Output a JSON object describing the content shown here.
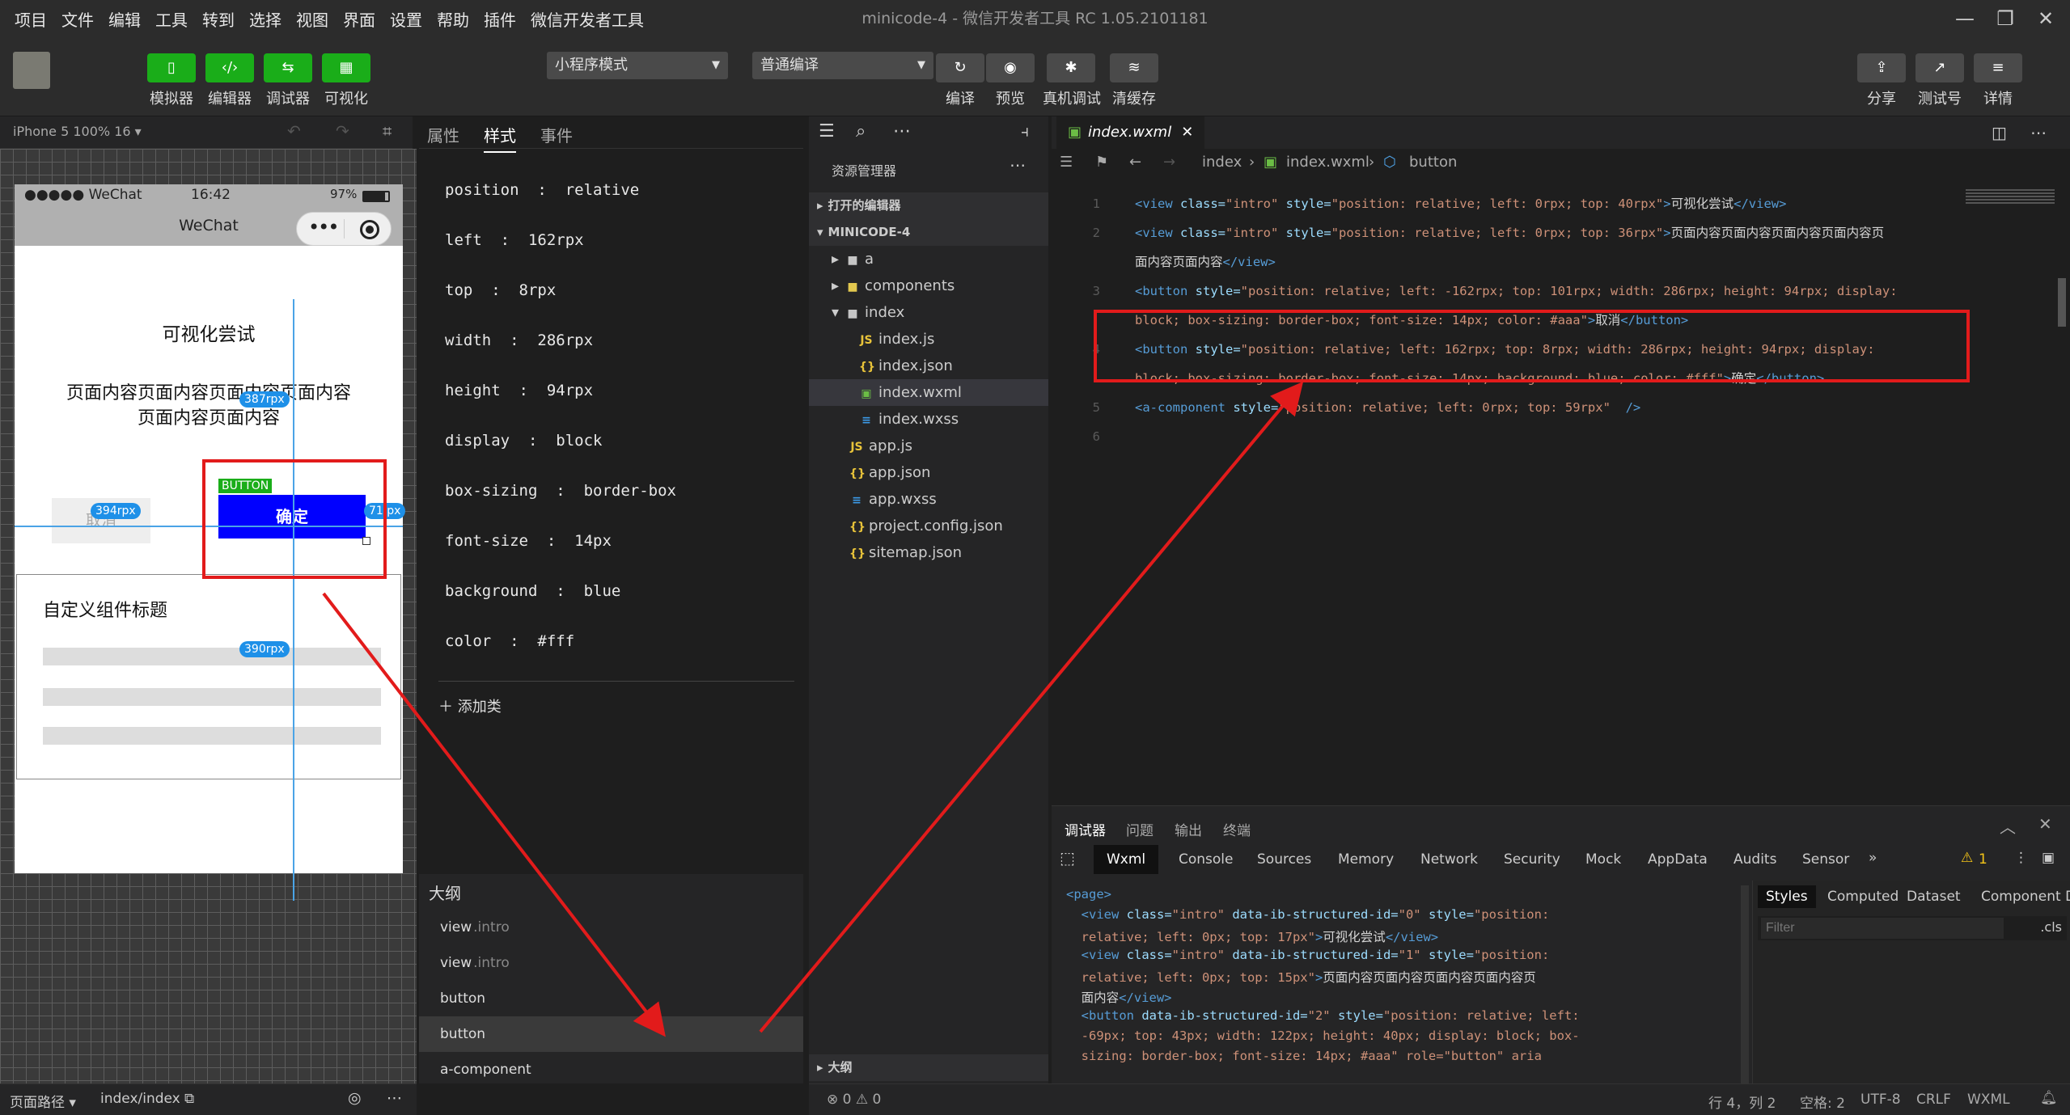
{
  "menubar": {
    "items": [
      "项目",
      "文件",
      "编辑",
      "工具",
      "转到",
      "选择",
      "视图",
      "界面",
      "设置",
      "帮助",
      "插件",
      "微信开发者工具"
    ],
    "title": "minicode-4 - 微信开发者工具 RC 1.05.2101181"
  },
  "toolbar": {
    "simulator": "模拟器",
    "editor": "编辑器",
    "debugger": "调试器",
    "visual": "可视化",
    "mode_select": "小程序模式",
    "compile_select": "普通编译",
    "compile": "编译",
    "preview": "预览",
    "real_debug": "真机调试",
    "clear_cache": "清缓存",
    "share": "分享",
    "test_account": "测试号",
    "details": "详情"
  },
  "simulator": {
    "device": "iPhone 5 100% 16 ▾",
    "status_carrier": "●●●●● WeChat",
    "status_time": "16:42",
    "status_battery": "97%",
    "nav_title": "WeChat",
    "text1": "可视化尝试",
    "text2_line1": "页面内容页面内容页面内容页面内容",
    "text2_line2": "页面内容页面内容",
    "cancel_btn": "取消",
    "confirm_btn": "确定",
    "button_tag": "BUTTON",
    "component_title": "自定义组件标题",
    "tag_394": "394rpx",
    "tag_387": "387rpx",
    "tag_71": "71 px",
    "tag_390": "390rpx"
  },
  "inspector": {
    "tab_attrs": "属性",
    "tab_style": "样式",
    "tab_events": "事件",
    "props": [
      {
        "k": "position",
        "v": "relative"
      },
      {
        "k": "left",
        "v": "162rpx"
      },
      {
        "k": "top",
        "v": "8rpx"
      },
      {
        "k": "width",
        "v": "286rpx"
      },
      {
        "k": "height",
        "v": "94rpx"
      },
      {
        "k": "display",
        "v": "block"
      },
      {
        "k": "box-sizing",
        "v": "border-box"
      },
      {
        "k": "font-size",
        "v": "14px"
      },
      {
        "k": "background",
        "v": "blue"
      },
      {
        "k": "color",
        "v": "#fff"
      }
    ],
    "add_class": "添加类"
  },
  "outline": {
    "title": "大纲",
    "items": [
      {
        "name": "view",
        "cls": ".intro"
      },
      {
        "name": "view",
        "cls": ".intro"
      },
      {
        "name": "button",
        "cls": ""
      },
      {
        "name": "button",
        "cls": ""
      },
      {
        "name": "a-component",
        "cls": ""
      }
    ]
  },
  "left_status": {
    "page_path_label": "页面路径 ▾",
    "page_path": "index/index"
  },
  "explorer": {
    "title": "资源管理器",
    "open_editors": "打开的编辑器",
    "project": "MINICODE-4",
    "outline": "大纲",
    "items": [
      {
        "name": "a",
        "kind": "folder"
      },
      {
        "name": "components",
        "kind": "folder"
      },
      {
        "name": "index",
        "kind": "folder-open"
      },
      {
        "name": "index.js",
        "kind": "js"
      },
      {
        "name": "index.json",
        "kind": "json"
      },
      {
        "name": "index.wxml",
        "kind": "wxml"
      },
      {
        "name": "index.wxss",
        "kind": "wxss"
      },
      {
        "name": "app.js",
        "kind": "js"
      },
      {
        "name": "app.json",
        "kind": "json"
      },
      {
        "name": "app.wxss",
        "kind": "wxss"
      },
      {
        "name": "project.config.json",
        "kind": "json"
      },
      {
        "name": "sitemap.json",
        "kind": "json"
      }
    ]
  },
  "editor": {
    "tab": "index.wxml",
    "crumb1": "index",
    "crumb2": "index.wxml",
    "crumb3": "button",
    "lines": [
      {
        "n": "1",
        "parts": [
          [
            "tg",
            "<view "
          ],
          [
            "at",
            "class="
          ],
          [
            "st",
            "\"intro\""
          ],
          [
            "at",
            " style="
          ],
          [
            "st",
            "\"position: relative; left: 0rpx; top: 40rpx\""
          ],
          [
            "tg",
            ">"
          ],
          [
            "tx",
            "可视化尝试"
          ],
          [
            "tg",
            "</view>"
          ]
        ]
      },
      {
        "n": "2",
        "parts": [
          [
            "tg",
            "<view "
          ],
          [
            "at",
            "class="
          ],
          [
            "st",
            "\"intro\""
          ],
          [
            "at",
            " style="
          ],
          [
            "st",
            "\"position: relative; left: 0rpx; top: 36rpx\""
          ],
          [
            "tg",
            ">"
          ],
          [
            "tx",
            "页面内容页面内容页面内容页面内容页"
          ]
        ]
      },
      {
        "n": "",
        "parts": [
          [
            "tx",
            "面内容页面内容"
          ],
          [
            "tg",
            "</view>"
          ]
        ]
      },
      {
        "n": "3",
        "parts": [
          [
            "tg",
            "<button "
          ],
          [
            "at",
            "style="
          ],
          [
            "st",
            "\"position: relative; left: -162rpx; top: 101rpx; width: 286rpx; height: 94rpx; display:"
          ]
        ]
      },
      {
        "n": "",
        "parts": [
          [
            "st",
            "block; box-sizing: border-box; font-size: 14px; color: #aaa\""
          ],
          [
            "tg",
            ">"
          ],
          [
            "tx",
            "取消"
          ],
          [
            "tg",
            "</button>"
          ]
        ]
      },
      {
        "n": "4",
        "parts": [
          [
            "tg",
            "<button "
          ],
          [
            "at",
            "style="
          ],
          [
            "st",
            "\"position: relative; left: 162rpx; top: 8rpx; width: 286rpx; height: 94rpx; display:"
          ]
        ]
      },
      {
        "n": "",
        "parts": [
          [
            "st",
            "block; box-sizing: border-box; font-size: 14px; background: blue; color: #fff\""
          ],
          [
            "tg",
            ">"
          ],
          [
            "tx",
            "确定"
          ],
          [
            "tg",
            "</button>"
          ]
        ]
      },
      {
        "n": "5",
        "parts": [
          [
            "tg",
            "<a-component "
          ],
          [
            "at",
            "style="
          ],
          [
            "st",
            "\"position: relative; left: 0rpx; top: 59rpx\""
          ],
          [
            "tg",
            "  />"
          ]
        ]
      },
      {
        "n": "6",
        "parts": []
      }
    ]
  },
  "debugger": {
    "tabs": [
      "调试器",
      "问题",
      "输出",
      "终端"
    ],
    "devtabs": [
      "Wxml",
      "Console",
      "Sources",
      "Memory",
      "Network",
      "Security",
      "Mock",
      "AppData",
      "Audits",
      "Sensor"
    ],
    "warn_count": "1",
    "styles_tabs": [
      "Styles",
      "Computed",
      "Dataset",
      "Component Data"
    ],
    "filter_placeholder": "Filter",
    "cls": ".cls",
    "code": [
      [
        [
          "tg",
          "<page>"
        ]
      ],
      [
        [
          "tg",
          "  <view "
        ],
        [
          "at",
          "class="
        ],
        [
          "st",
          "\"intro\""
        ],
        [
          "at",
          " data-ib-structured-id="
        ],
        [
          "st",
          "\"0\""
        ],
        [
          "at",
          " style="
        ],
        [
          "st",
          "\"position:"
        ]
      ],
      [
        [
          "st",
          "  relative; left: 0px; top: 17px\""
        ],
        [
          "tg",
          ">"
        ],
        [
          "tx",
          "可视化尝试"
        ],
        [
          "tg",
          "</view>"
        ]
      ],
      [
        [
          "tg",
          "  <view "
        ],
        [
          "at",
          "class="
        ],
        [
          "st",
          "\"intro\""
        ],
        [
          "at",
          " data-ib-structured-id="
        ],
        [
          "st",
          "\"1\""
        ],
        [
          "at",
          " style="
        ],
        [
          "st",
          "\"position:"
        ]
      ],
      [
        [
          "st",
          "  relative; left: 0px; top: 15px\""
        ],
        [
          "tg",
          ">"
        ],
        [
          "tx",
          "页面内容页面内容页面内容页面内容页"
        ]
      ],
      [
        [
          "tx",
          "  面内容"
        ],
        [
          "tg",
          "</view>"
        ]
      ],
      [
        [
          "tg",
          "  <button "
        ],
        [
          "at",
          "data-ib-structured-id="
        ],
        [
          "st",
          "\"2\""
        ],
        [
          "at",
          " style="
        ],
        [
          "st",
          "\"position: relative; left:"
        ]
      ],
      [
        [
          "st",
          "  -69px; top: 43px; width: 122px; height: 40px; display: block; box-"
        ]
      ],
      [
        [
          "st",
          "  sizing: border-box; font-size: 14px; #aaa\" role=\"button\" aria"
        ]
      ]
    ]
  },
  "statusbar": {
    "errors": "⊗ 0 ⚠ 0",
    "position": "行 4，列 2",
    "spaces": "空格: 2",
    "encoding": "UTF-8",
    "eol": "CRLF",
    "lang": "WXML"
  },
  "colors": {
    "accent_green": "#1aad19",
    "highlight_red": "#e21b1b",
    "button_blue": "#0000ff"
  }
}
